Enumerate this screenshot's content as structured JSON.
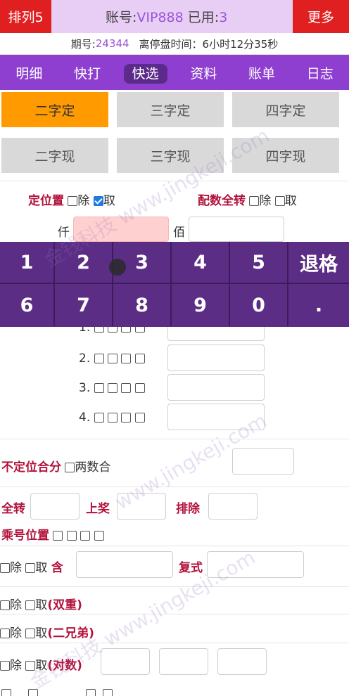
{
  "header": {
    "left_button": "排列5",
    "right_button": "更多",
    "account_label": "账号:",
    "account_value": "VIP888",
    "used_label": "已用:",
    "used_value": "3"
  },
  "period": {
    "label": "期号:",
    "value": "24344",
    "close_text": "离停盘时间：6小时12分35秒"
  },
  "nav": [
    "明细",
    "快打",
    "快选",
    "资料",
    "账单",
    "日志"
  ],
  "modes_row1": [
    "二字定",
    "三字定",
    "四字定"
  ],
  "modes_row2": [
    "二字现",
    "三字现",
    "四字现"
  ],
  "options": {
    "fixed_position": "定位置",
    "remove": "除",
    "take": "取",
    "count_all": "配数全转"
  },
  "digits": {
    "qian": "仟",
    "bai": "佰"
  },
  "keypad_row1": [
    "1",
    "2",
    "3",
    "4",
    "5",
    "退格"
  ],
  "keypad_row2": [
    "6",
    "7",
    "8",
    "9",
    "0",
    "."
  ],
  "list_rows": [
    "1.",
    "2.",
    "3.",
    "4."
  ],
  "unfixed": {
    "label": "不定位合分",
    "two_sum": "两数合"
  },
  "transform": {
    "all": "全转",
    "up": "上奖",
    "exclude": "排除",
    "multiply": "乘号位置"
  },
  "contains": {
    "remove": "除",
    "take": "取",
    "contains": "含",
    "compound": "复式"
  },
  "double": {
    "remove": "除",
    "take": "取",
    "label": "(双重)"
  },
  "brothers": {
    "remove": "除",
    "take": "取",
    "label": "(二兄弟)"
  },
  "pairs": {
    "remove": "除",
    "take": "取",
    "label": "(对数)"
  },
  "watermark": [
    "金钱科技 www.jingkeji.com",
    "www.jingkeji.com",
    "金钱科技 www.jingkeji.com"
  ]
}
